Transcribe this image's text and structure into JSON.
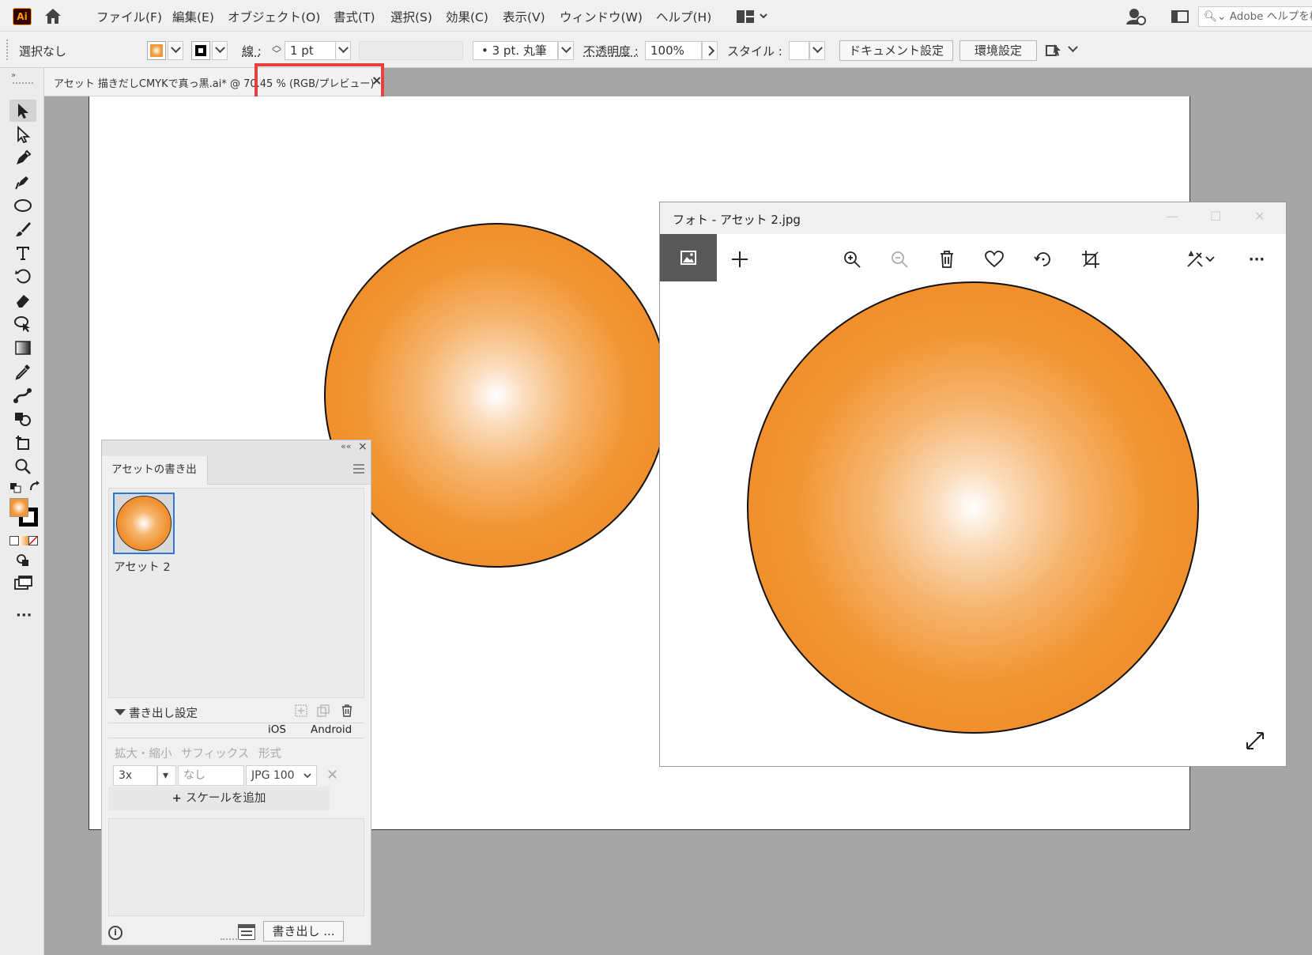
{
  "menu": {
    "items": [
      "ファイル(F)",
      "編集(E)",
      "オブジェクト(O)",
      "書式(T)",
      "選択(S)",
      "効果(C)",
      "表示(V)",
      "ウィンドウ(W)",
      "ヘルプ(H)"
    ],
    "logo": "Ai",
    "search_placeholder": "Adobe ヘルプを検"
  },
  "control": {
    "selection": "選択なし",
    "stroke_label": "線 :",
    "stroke_weight": "1 pt",
    "brush": "3 pt. 丸筆",
    "opacity_label": "不透明度 :",
    "opacity": "100%",
    "style_label": "スタイル :",
    "doc_settings": "ドキュメント設定",
    "preferences": "環境設定",
    "fill_color": "#f29634",
    "stroke_color": "#000000"
  },
  "document": {
    "tab_label": "アセット 描きだしCMYKで真っ黒.ai* @ 70.45 % (RGB/プレビュー)",
    "close_symbol": "×"
  },
  "photos": {
    "title": "フォト - アセット 2.jpg",
    "min": "—",
    "max": "☐",
    "close": "✕",
    "more": "···"
  },
  "asset_panel": {
    "collapse": "««",
    "close": "×",
    "tab_label": "アセットの書き出し",
    "asset_name": "アセット 2",
    "export_settings_label": "書き出し設定",
    "platform_ios": "iOS",
    "platform_android": "Android",
    "col_scale": "拡大・縮小",
    "col_suffix": "サフィックス",
    "col_format": "形式",
    "scale_value": "3x",
    "suffix_placeholder": "なし",
    "format_value": "JPG 100",
    "add_scale": "スケールを追加",
    "export_button": "書き出し ...",
    "info": "i"
  },
  "colors": {
    "highlight": "#e84040",
    "orange": "#ee8b28",
    "selection_blue": "#2a7bd8"
  }
}
